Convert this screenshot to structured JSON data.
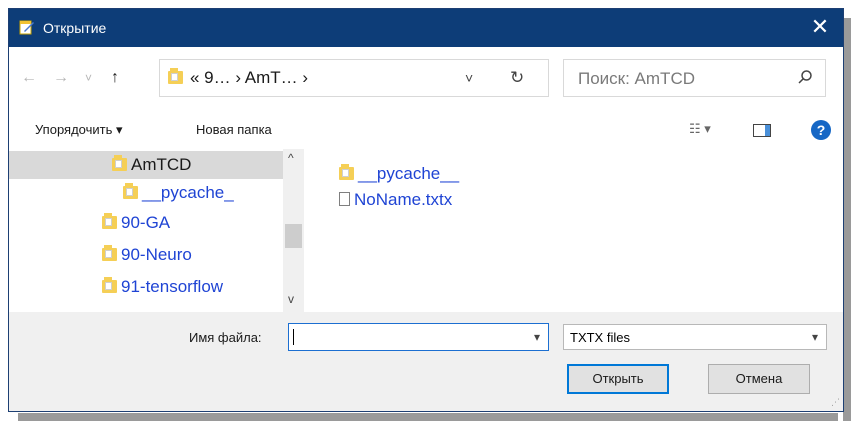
{
  "window": {
    "title": "Открытие",
    "close_glyph": "✕"
  },
  "nav": {
    "back": "←",
    "forward": "→",
    "recent": "˅",
    "up": "↑"
  },
  "address": {
    "crumbs": "« 9… › AmT… ›",
    "dropdown": "˅",
    "refresh": "↻"
  },
  "search": {
    "placeholder": "Поиск: AmTCD",
    "icon": "search-icon"
  },
  "toolbar": {
    "organize": "Упорядочить ▾",
    "new_folder": "Новая папка",
    "views": "☷ ▾"
  },
  "tree": {
    "items": [
      {
        "label": "AmTCD",
        "selected": true
      },
      {
        "label": "__pycache_"
      },
      {
        "label": "90-GA"
      },
      {
        "label": "90-Neuro"
      },
      {
        "label": "91-tensorflow"
      }
    ]
  },
  "files": [
    {
      "name": "__pycache__",
      "type": "folder"
    },
    {
      "name": "NoName.txtx",
      "type": "file"
    }
  ],
  "bottom": {
    "filename_label": "Имя файла:",
    "filename_value": "",
    "filetype": "TXTX files",
    "open": "Открыть",
    "cancel": "Отмена"
  },
  "colors": {
    "titlebar": "#0d3d78",
    "link": "#1f44d4",
    "accent": "#0078d7"
  }
}
